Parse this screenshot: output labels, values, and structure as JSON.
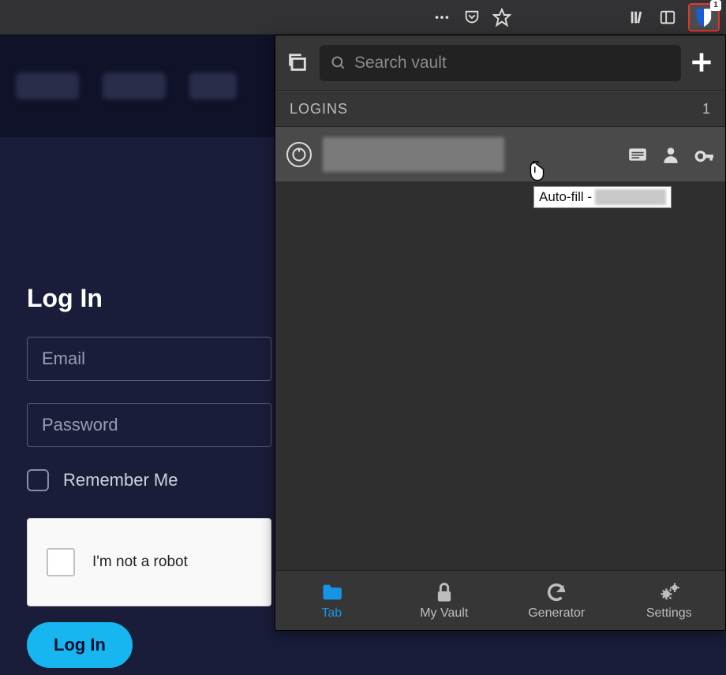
{
  "browser": {
    "badge": "1"
  },
  "page": {
    "login_title": "Log In",
    "email_placeholder": "Email",
    "password_placeholder": "Password",
    "remember_label": "Remember Me",
    "captcha_label": "I'm not a robot",
    "login_button": "Log In"
  },
  "popup": {
    "search_placeholder": "Search vault",
    "section_label": "LOGINS",
    "section_count": "1",
    "tabs": {
      "tab": "Tab",
      "vault": "My Vault",
      "generator": "Generator",
      "settings": "Settings"
    }
  },
  "tooltip": {
    "prefix": "Auto-fill - "
  }
}
